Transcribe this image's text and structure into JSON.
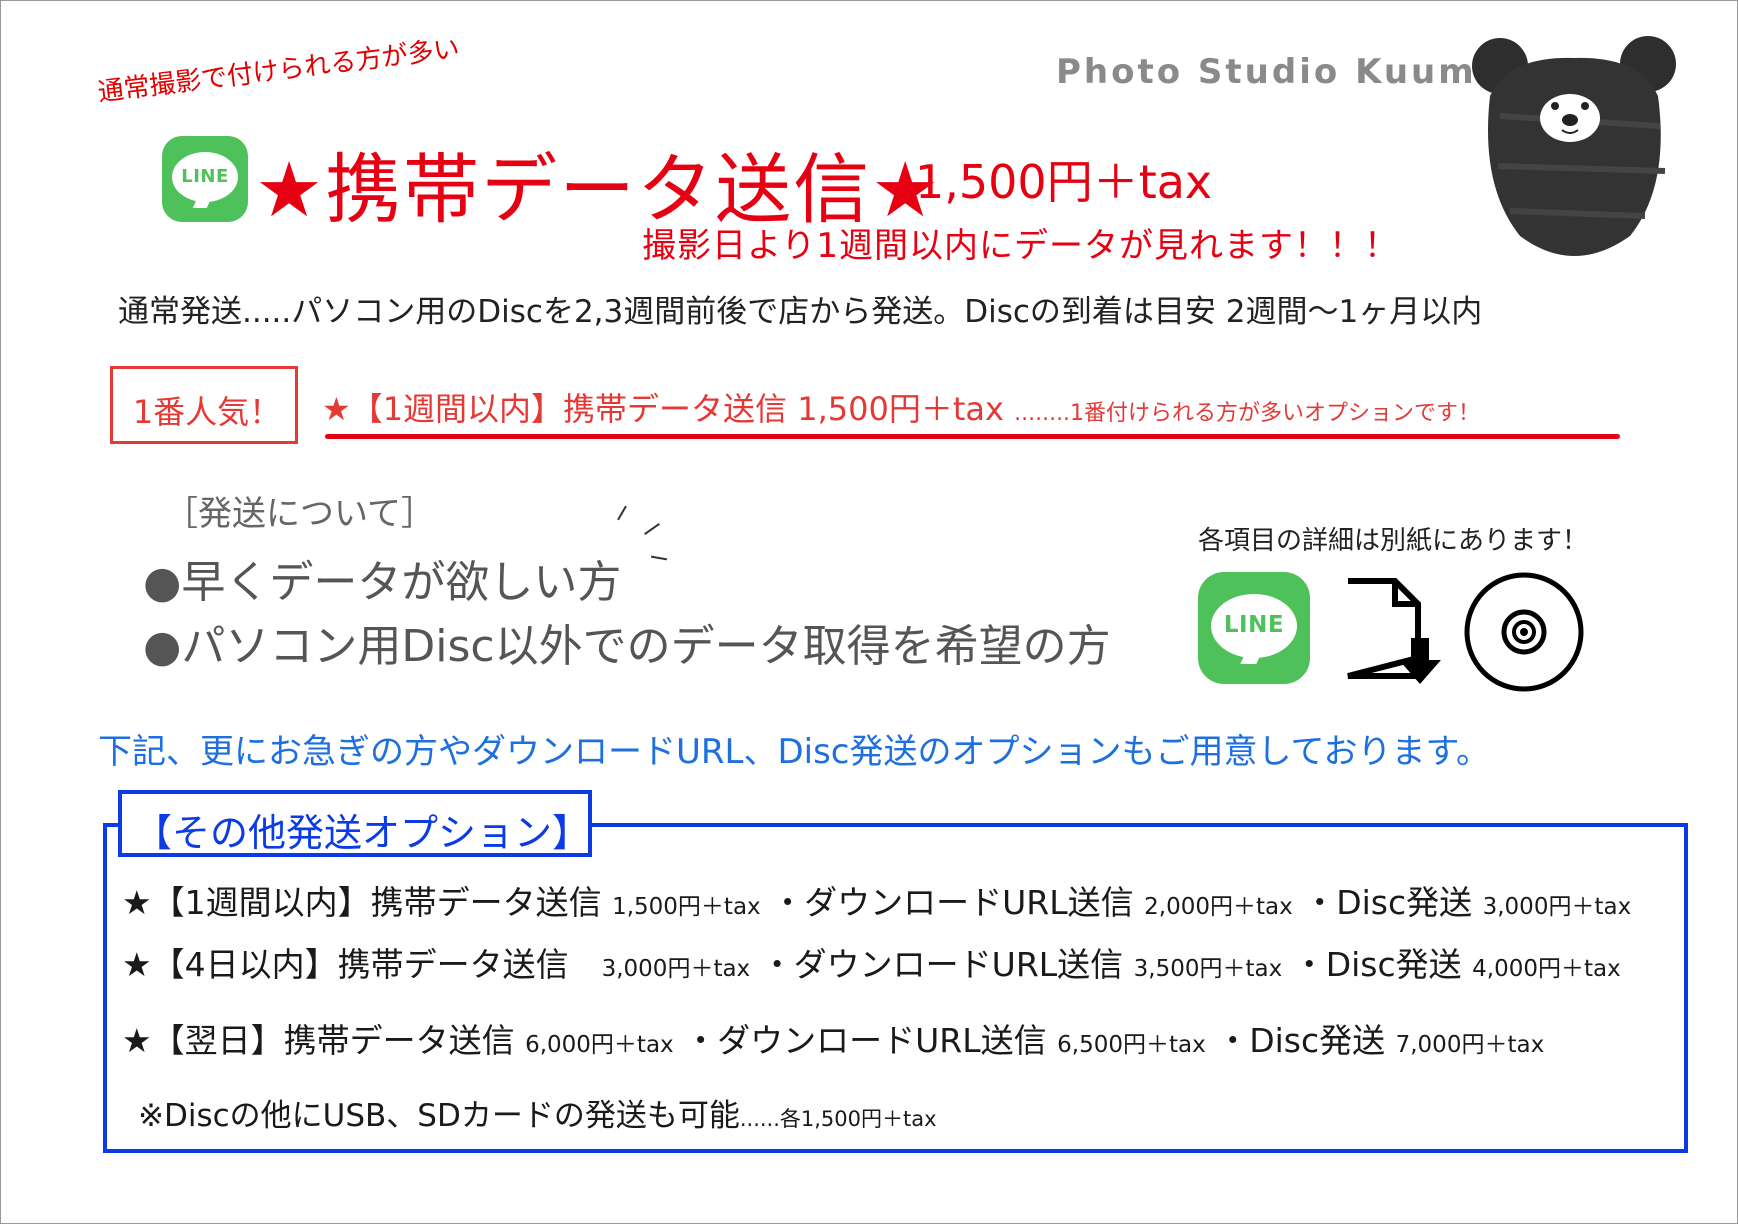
{
  "brand": "Photo Studio Kuuma",
  "note_tilt": "通常撮影で付けられる方が多い",
  "line_icon_text": "LINE",
  "hero": {
    "title": "★携帯データ送信★",
    "price": "1,500円＋tax",
    "subtitle": "撮影日より1週間以内にデータが見れます！！！"
  },
  "normal_shipping": "通常発送.....パソコン用のDiscを2,3週間前後で店から発送。Discの到着は目安 2週間〜1ヶ月以内",
  "popular": {
    "badge": "1番人気！",
    "text": "★【1週間以内】携帯データ送信 1,500円＋tax ",
    "note": "........1番付けられる方が多いオプションです！"
  },
  "shipping_about": {
    "heading": "［発送について］",
    "bullets": [
      "●早くデータが欲しい方",
      "●パソコン用Disc以外でのデータ取得を希望の方"
    ]
  },
  "detail_note": "各項目の詳細は別紙にあります！",
  "icons": [
    "line-app-icon",
    "file-download-icon",
    "disc-icon"
  ],
  "blue_note": "下記、更にお急ぎの方やダウンロードURL、Disc発送のオプションもご用意しております。",
  "other_options": {
    "title": "【その他発送オプション】",
    "rows": [
      {
        "a": "★【1週間以内】携帯データ送信 ",
        "ap": "1,500円＋tax",
        "b": "・ダウンロードURL送信 ",
        "bp": "2,000円＋tax",
        "c": "・Disc発送 ",
        "cp": "3,000円＋tax"
      },
      {
        "a": "★【4日以内】携帯データ送信　",
        "ap": "3,000円＋tax",
        "b": "・ダウンロードURL送信 ",
        "bp": "3,500円＋tax",
        "c": "・Disc発送 ",
        "cp": "4,000円＋tax"
      },
      {
        "a": "★【翌日】携帯データ送信 ",
        "ap": "6,000円＋tax",
        "b": "・ダウンロードURL送信 ",
        "bp": "6,500円＋tax",
        "c": "・Disc発送 ",
        "cp": "7,000円＋tax"
      }
    ],
    "footnote": "※Discの他にUSB、SDカードの発送も可能",
    "footnote_price": "......各1,500円＋tax"
  },
  "colors": {
    "accent_red": "#e60012",
    "accent_blue": "#0a3be6",
    "link_blue": "#1e6fe0",
    "line_green": "#4fc15a"
  }
}
